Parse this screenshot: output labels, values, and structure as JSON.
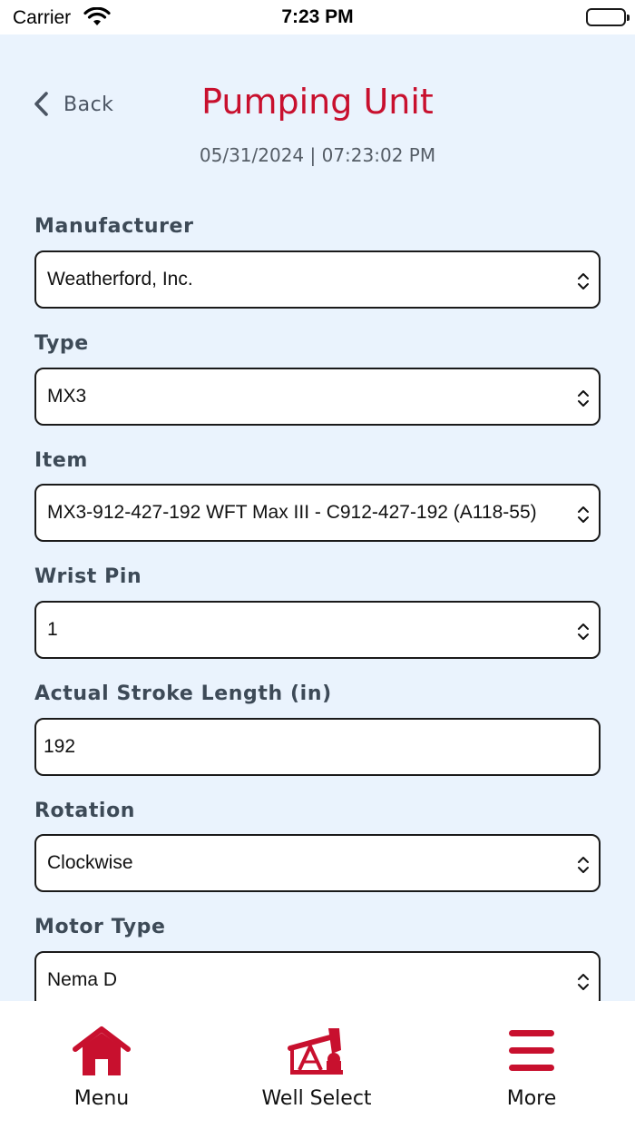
{
  "status_bar": {
    "carrier": "Carrier",
    "time": "7:23 PM"
  },
  "header": {
    "back_label": "Back",
    "title": "Pumping Unit",
    "timestamp": "05/31/2024 | 07:23:02 PM"
  },
  "form": {
    "manufacturer": {
      "label": "Manufacturer",
      "value": "Weatherford, Inc."
    },
    "type": {
      "label": "Type",
      "value": "MX3"
    },
    "item": {
      "label": "Item",
      "value": "MX3-912-427-192 WFT Max III - C912-427-192 (A118-55)"
    },
    "wrist_pin": {
      "label": "Wrist Pin",
      "value": "1"
    },
    "stroke_length": {
      "label": "Actual Stroke Length (in)",
      "value": "192"
    },
    "rotation": {
      "label": "Rotation",
      "value": "Clockwise"
    },
    "motor_type": {
      "label": "Motor Type",
      "value": "Nema D"
    }
  },
  "tab_bar": {
    "items": [
      {
        "label": "Menu",
        "icon": "home-icon"
      },
      {
        "label": "Well Select",
        "icon": "pumpjack-icon"
      },
      {
        "label": "More",
        "icon": "hamburger-icon"
      }
    ]
  },
  "colors": {
    "accent": "#c8102e",
    "background": "#eaf3fd",
    "label": "#3d4a57"
  }
}
